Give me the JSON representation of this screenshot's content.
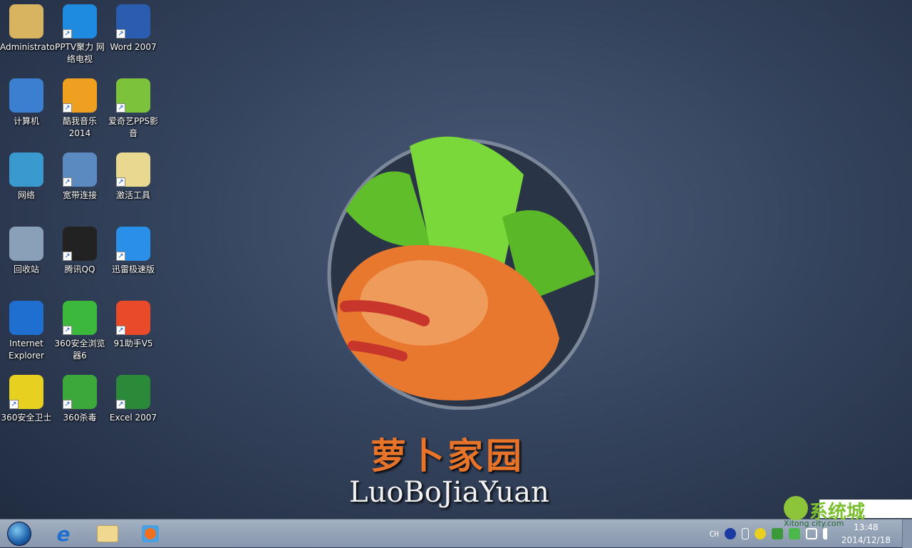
{
  "desktop_icons": [
    {
      "label": "Administrator",
      "icon": "user-folder-icon",
      "color": "#d8b460"
    },
    {
      "label": "PPTV聚力 网络电视",
      "icon": "pptv-icon",
      "color": "#1e8be0",
      "shortcut": true
    },
    {
      "label": "Word 2007",
      "icon": "word-icon",
      "color": "#2a5db0",
      "shortcut": true
    },
    {
      "label": "计算机",
      "icon": "computer-icon",
      "color": "#3a7fd0"
    },
    {
      "label": "酷我音乐 2014",
      "icon": "kuwo-music-icon",
      "color": "#f0a020",
      "shortcut": true
    },
    {
      "label": "爱奇艺PPS影音",
      "icon": "iqiyi-pps-icon",
      "color": "#7cc23a",
      "shortcut": true
    },
    {
      "label": "网络",
      "icon": "network-icon",
      "color": "#3a9ad0"
    },
    {
      "label": "宽带连接",
      "icon": "broadband-icon",
      "color": "#5a8ac0",
      "shortcut": true
    },
    {
      "label": "激活工具",
      "icon": "folder-icon",
      "color": "#e8d890",
      "shortcut": true
    },
    {
      "label": "回收站",
      "icon": "recycle-bin-icon",
      "color": "#8aa0b8"
    },
    {
      "label": "腾讯QQ",
      "icon": "qq-icon",
      "color": "#222222",
      "shortcut": true
    },
    {
      "label": "迅雷极速版",
      "icon": "thunder-icon",
      "color": "#2a8fe8",
      "shortcut": true
    },
    {
      "label": "Internet Explorer",
      "icon": "ie-icon",
      "color": "#1e6fd0"
    },
    {
      "label": "360安全浏览器6",
      "icon": "360-browser-icon",
      "color": "#3cb83c",
      "shortcut": true
    },
    {
      "label": "91助手V5",
      "icon": "91-assistant-icon",
      "color": "#e84a2a",
      "shortcut": true
    },
    {
      "label": "360安全卫士",
      "icon": "360-safe-icon",
      "color": "#e8d020",
      "shortcut": true
    },
    {
      "label": "360杀毒",
      "icon": "360-antivirus-icon",
      "color": "#3ca83c",
      "shortcut": true
    },
    {
      "label": "Excel 2007",
      "icon": "excel-icon",
      "color": "#2a8a3a",
      "shortcut": true
    }
  ],
  "wallpaper": {
    "title_cn": "萝卜家园",
    "title_en": "LuoBoJiaYuan"
  },
  "taskbar": {
    "pinned": [
      {
        "icon": "start-orb-icon"
      },
      {
        "icon": "ie-icon"
      },
      {
        "icon": "explorer-icon"
      },
      {
        "icon": "media-player-icon"
      }
    ],
    "tray": {
      "language": "CH",
      "time": "13:48",
      "date": "2014/12/18"
    }
  },
  "watermark": {
    "text": "系统城",
    "sub": "Xitong city.com"
  }
}
